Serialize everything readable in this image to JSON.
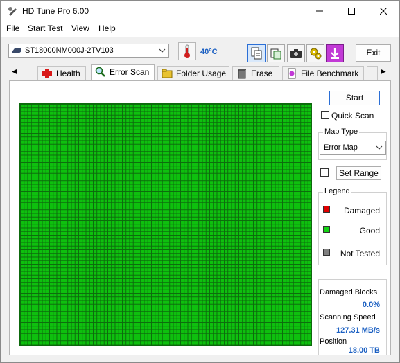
{
  "app": {
    "title": "HD Tune Pro 6.00"
  },
  "menu": {
    "file": "File",
    "start_test": "Start Test",
    "view": "View",
    "help": "Help"
  },
  "toolbar": {
    "drive": "ST18000NM000J-2TV103",
    "temperature": "40°C",
    "exit_label": "Exit"
  },
  "tabs": [
    {
      "label": "Health"
    },
    {
      "label": "Error Scan"
    },
    {
      "label": "Folder Usage"
    },
    {
      "label": "Erase"
    },
    {
      "label": "File Benchmark"
    }
  ],
  "error_scan": {
    "start_label": "Start",
    "quick_scan_label": "Quick Scan",
    "map_type_title": "Map Type",
    "map_type_value": "Error Map",
    "set_range_label": "Set Range",
    "legend_title": "Legend",
    "legend": [
      {
        "label": "Damaged",
        "color": "#e00000"
      },
      {
        "label": "Good",
        "color": "#14d414"
      },
      {
        "label": "Not Tested",
        "color": "#808080"
      }
    ],
    "damaged_blocks_label": "Damaged Blocks",
    "damaged_blocks_value": "0.0%",
    "scanning_speed_label": "Scanning Speed",
    "scanning_speed_value": "127.31 MB/s",
    "position_label": "Position",
    "position_value": "18.00 TB"
  },
  "colors": {
    "accent": "#1a5fc2",
    "good_block": "#0ec00e",
    "grid_line": "#0d6a0d"
  }
}
